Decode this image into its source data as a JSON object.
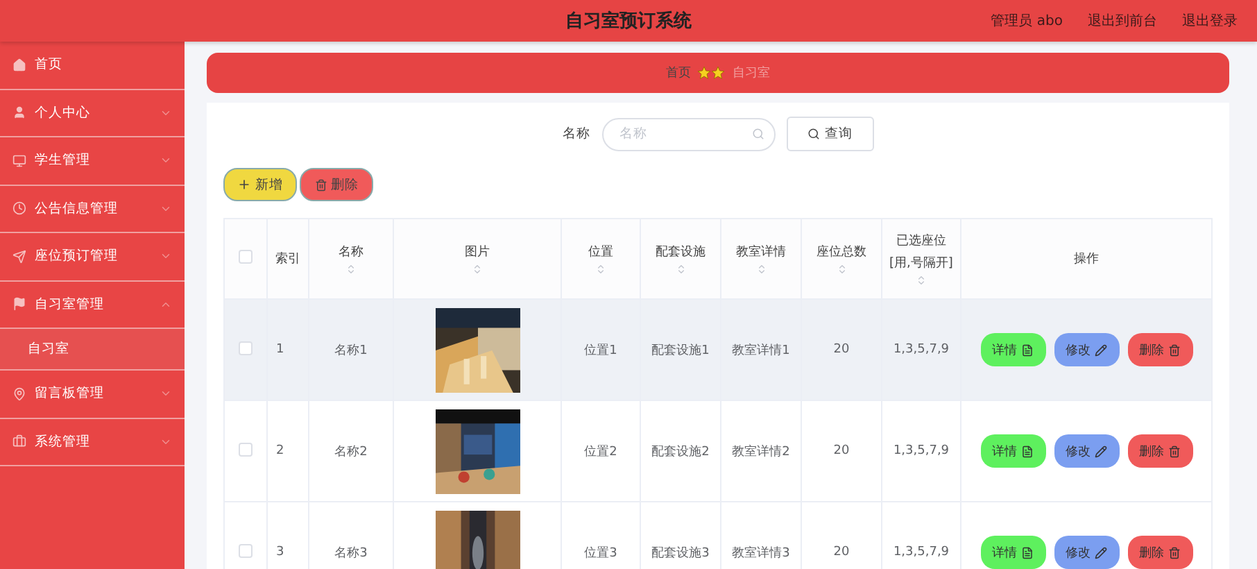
{
  "header": {
    "title": "自习室预订系统",
    "links": [
      "管理员 abo",
      "退出到前台",
      "退出登录"
    ]
  },
  "sidebar": {
    "items": [
      {
        "label": "首页"
      },
      {
        "label": "个人中心",
        "expanded": false
      },
      {
        "label": "学生管理",
        "expanded": false
      },
      {
        "label": "公告信息管理",
        "expanded": false
      },
      {
        "label": "座位预订管理",
        "expanded": false
      },
      {
        "label": "自习室管理",
        "expanded": true,
        "children": [
          {
            "label": "自习室",
            "selected": true
          }
        ]
      },
      {
        "label": "留言板管理",
        "expanded": false
      },
      {
        "label": "系统管理",
        "expanded": false
      }
    ]
  },
  "breadcrumb": {
    "items": [
      "首页",
      "自习室"
    ]
  },
  "search": {
    "label": "名称",
    "placeholder": "名称",
    "button": "查询"
  },
  "toolbar": {
    "add": "新增",
    "delete": "删除"
  },
  "table": {
    "select_all_checked": false,
    "columns": [
      {
        "label": "索引",
        "sortable": false
      },
      {
        "label": "名称",
        "sortable": true
      },
      {
        "label": "图片",
        "sortable": true
      },
      {
        "label": "位置",
        "sortable": true
      },
      {
        "label": "配套设施",
        "sortable": true
      },
      {
        "label": "教室详情",
        "sortable": true
      },
      {
        "label": "座位总数",
        "sortable": true
      },
      {
        "label": "已选座位[用,号隔开]",
        "sortable": true
      },
      {
        "label": "操作",
        "sortable": false
      }
    ],
    "rows": [
      {
        "checked": false,
        "hovered": true,
        "cells": [
          "1",
          "名称1",
          {
            "kind": "picture"
          },
          "位置1",
          "配套设施1",
          "教室详情1",
          "20",
          "1,3,5,7,9"
        ],
        "actions": [
          "详情",
          "修改",
          "删除"
        ]
      },
      {
        "checked": false,
        "hovered": false,
        "cells": [
          "2",
          "名称2",
          {
            "kind": "picture"
          },
          "位置2",
          "配套设施2",
          "教室详情2",
          "20",
          "1,3,5,7,9"
        ],
        "actions": [
          "详情",
          "修改",
          "删除"
        ]
      },
      {
        "checked": false,
        "hovered": false,
        "cells": [
          "3",
          "名称3",
          {
            "kind": "picture"
          },
          "位置3",
          "配套设施3",
          "教室详情3",
          "20",
          "1,3,5,7,9"
        ],
        "actions": [
          "详情",
          "修改",
          "删除"
        ]
      }
    ]
  }
}
